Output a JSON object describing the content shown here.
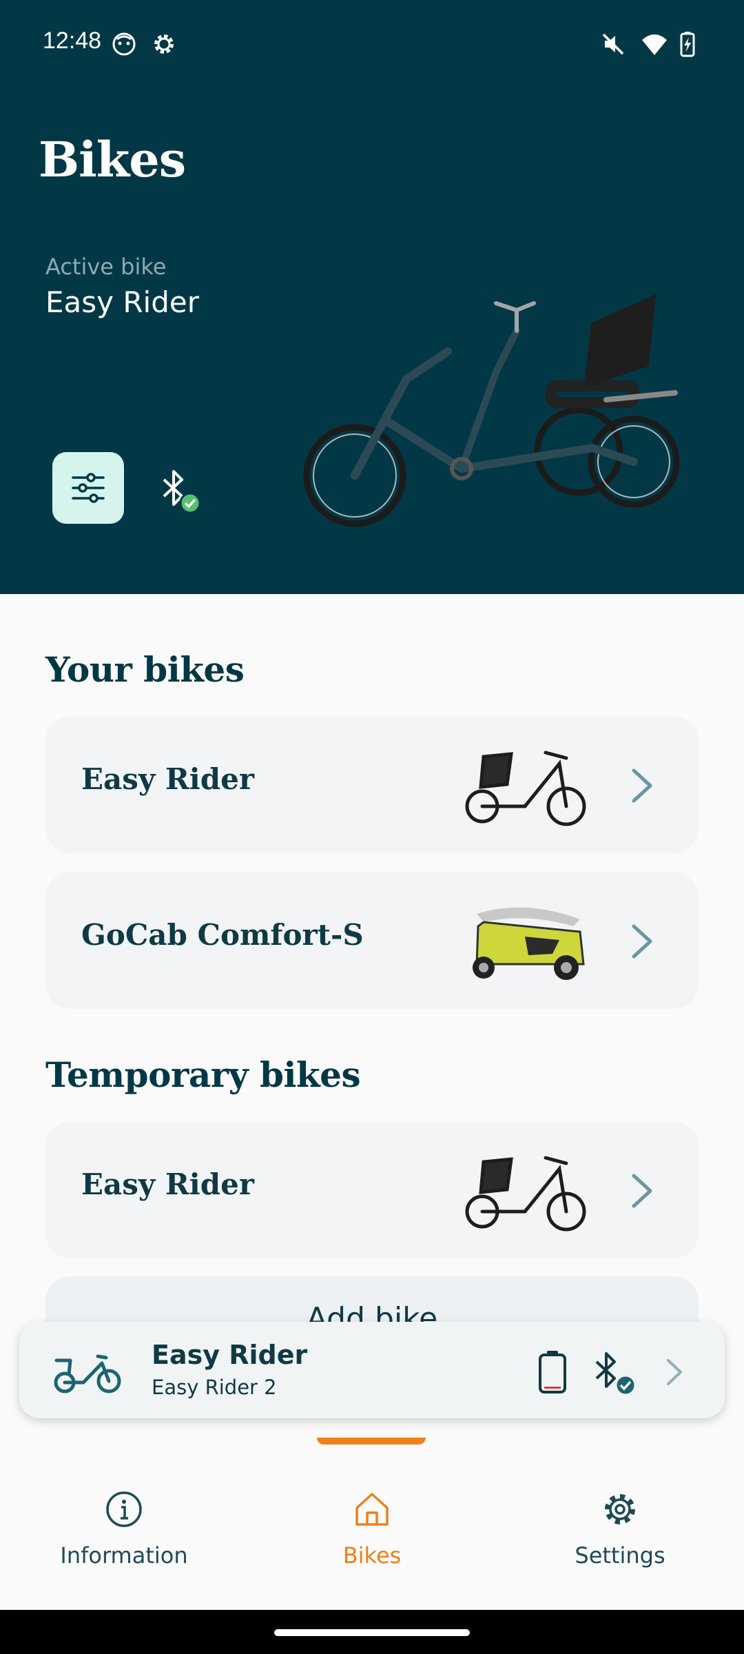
{
  "status_bar": {
    "time": "12:48",
    "icons": [
      "face-notification-icon",
      "gear-icon",
      "mute-icon",
      "wifi-icon",
      "battery-charging-icon"
    ]
  },
  "header": {
    "title": "Bikes",
    "active_label": "Active bike",
    "active_name": "Easy Rider",
    "settings_icon": "sliders-icon",
    "bluetooth_icon": "bluetooth-connected-icon"
  },
  "your_bikes": {
    "title": "Your bikes",
    "items": [
      {
        "name": "Easy Rider",
        "image": "easy-rider-thumbnail"
      },
      {
        "name": "GoCab Comfort-S",
        "image": "gocab-thumbnail"
      }
    ]
  },
  "temporary_bikes": {
    "title": "Temporary bikes",
    "items": [
      {
        "name": "Easy Rider",
        "image": "easy-rider-thumbnail"
      }
    ]
  },
  "add_bike_label": "Add bike",
  "mini_card": {
    "title": "Easy Rider",
    "subtitle": "Easy Rider 2",
    "battery_icon": "battery-low-icon",
    "bluetooth_icon": "bluetooth-connected-icon"
  },
  "bottom_nav": {
    "items": [
      {
        "label": "Information",
        "icon": "info-icon"
      },
      {
        "label": "Bikes",
        "icon": "home-icon",
        "active": true
      },
      {
        "label": "Settings",
        "icon": "gear-icon"
      }
    ]
  },
  "colors": {
    "header_bg": "#023846",
    "accent": "#f08018",
    "card_bg": "#f2f4f6",
    "mint": "#d5f4ee",
    "check_green": "#55c070",
    "dark_text": "#0f3a45"
  }
}
